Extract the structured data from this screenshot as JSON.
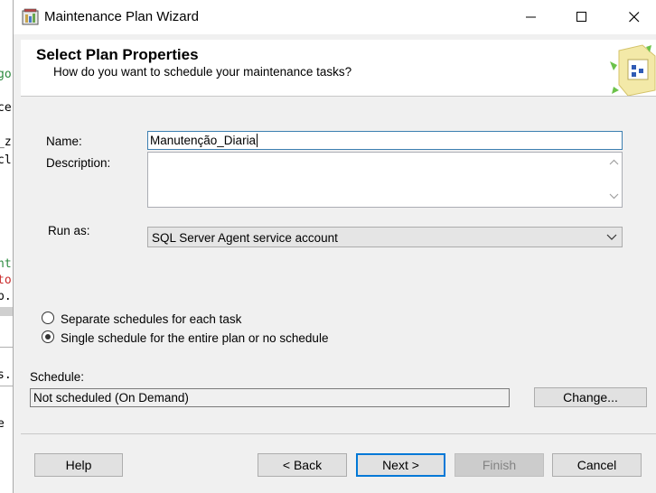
{
  "window": {
    "title": "Maintenance Plan Wizard"
  },
  "header": {
    "title": "Select Plan Properties",
    "subtitle": "How do you want to schedule your maintenance tasks?"
  },
  "form": {
    "name_label": "Name:",
    "name_value": "Manutenção_Diaria",
    "description_label": "Description:",
    "description_value": "",
    "runas_label": "Run as:",
    "runas_value": "SQL Server Agent service account"
  },
  "schedule_options": {
    "separate": {
      "label": "Separate schedules for each task",
      "checked": false
    },
    "single": {
      "label": "Single schedule for the entire plan or no schedule",
      "checked": true
    }
  },
  "schedule": {
    "label": "Schedule:",
    "value": "Not scheduled (On Demand)",
    "change_button": "Change..."
  },
  "buttons": {
    "help": "Help",
    "back": "< Back",
    "next": "Next >",
    "finish": "Finish",
    "cancel": "Cancel"
  },
  "background_editor_fragments": [
    "go",
    "ce",
    "_z",
    "cl",
    "nt",
    "to",
    "p.",
    "s.",
    "e"
  ],
  "colors": {
    "accent_focus": "#0078d7",
    "window_bg": "#f0f0f0",
    "disabled_text": "#838383"
  }
}
